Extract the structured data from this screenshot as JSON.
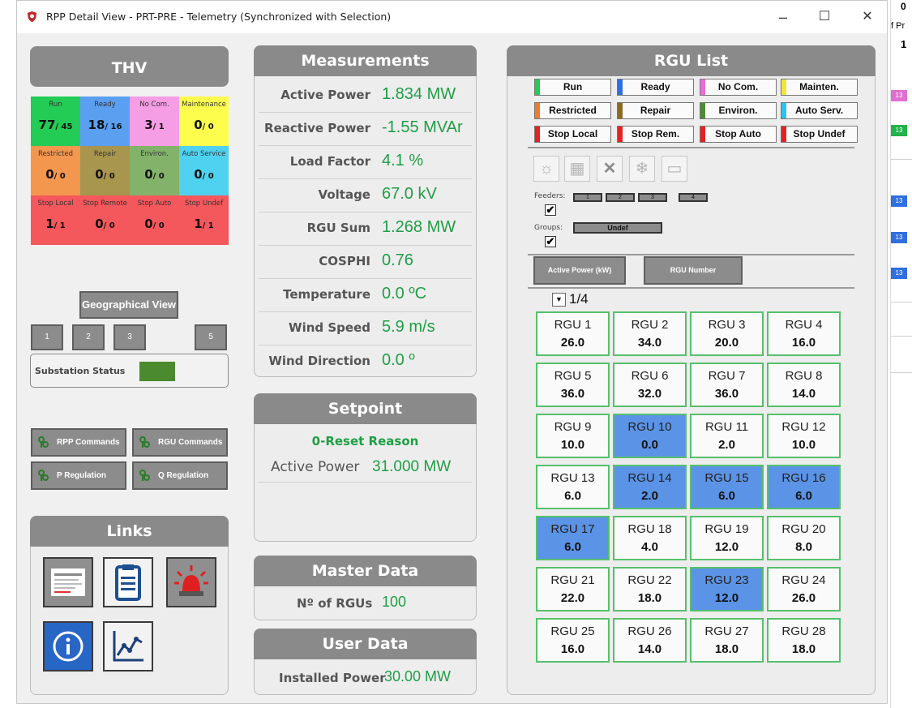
{
  "window": {
    "title": "RPP Detail View - PRT-PRE - Telemetry (Synchronized with Selection)",
    "minimize": "–",
    "maximize": "☐",
    "close": "✕"
  },
  "thv": {
    "title": "THV",
    "cells": [
      {
        "label": "Run",
        "count": "77",
        "sub": "45",
        "color": "#22cc55"
      },
      {
        "label": "Ready",
        "count": "18",
        "sub": "16",
        "color": "#5a9ff0"
      },
      {
        "label": "No Com.",
        "count": "3",
        "sub": "1",
        "color": "#f59de5"
      },
      {
        "label": "Maintenance",
        "count": "0",
        "sub": "0",
        "color": "#fdfd4e"
      },
      {
        "label": "Restricted",
        "count": "0",
        "sub": "0",
        "color": "#f3964e"
      },
      {
        "label": "Repair",
        "count": "0",
        "sub": "0",
        "color": "#a8954e"
      },
      {
        "label": "Environ.",
        "count": "0",
        "sub": "0",
        "color": "#83b36a"
      },
      {
        "label": "Auto Service",
        "count": "0",
        "sub": "0",
        "color": "#4fd2f0"
      },
      {
        "label": "Stop Local",
        "count": "1",
        "sub": "1",
        "color": "#f4585c"
      },
      {
        "label": "Stop Remote",
        "count": "0",
        "sub": "0",
        "color": "#f4585c"
      },
      {
        "label": "Stop Auto",
        "count": "0",
        "sub": "0",
        "color": "#f4585c"
      },
      {
        "label": "Stop Undef",
        "count": "1",
        "sub": "1",
        "color": "#f4585c"
      }
    ]
  },
  "geo": {
    "label": "Geographical View",
    "buttons": [
      "1",
      "2",
      "3",
      "5"
    ]
  },
  "substation": {
    "label": "Substation Status",
    "color": "#4b8a2e"
  },
  "commands": {
    "rpp": "RPP Commands",
    "rgu": "RGU Commands",
    "p_reg": "P Regulation",
    "q_reg": "Q Regulation"
  },
  "links": {
    "title": "Links",
    "icons": [
      "report-icon",
      "clipboard-icon",
      "alarm-siren-icon",
      "info-icon",
      "trend-chart-icon"
    ]
  },
  "measurements": {
    "title": "Measurements",
    "rows": [
      {
        "label": "Active Power",
        "value": "1.834 MW"
      },
      {
        "label": "Reactive Power",
        "value": "-1.55 MVAr"
      },
      {
        "label": "Load Factor",
        "value": "4.1 %"
      },
      {
        "label": "Voltage",
        "value": "67.0 kV"
      },
      {
        "label": "RGU Sum",
        "value": "1.268 MW"
      },
      {
        "label": "COSPHI",
        "value": "0.76"
      },
      {
        "label": "Temperature",
        "value": "0.0 ºC"
      },
      {
        "label": "Wind Speed",
        "value": "5.9 m/s"
      },
      {
        "label": "Wind Direction",
        "value": "0.0 º"
      }
    ]
  },
  "setpoint": {
    "title": "Setpoint",
    "reason": "0-Reset Reason",
    "active_power_label": "Active Power",
    "active_power_value": "31.000 MW"
  },
  "master_data": {
    "title": "Master Data",
    "label": "Nº of RGUs",
    "value": "100"
  },
  "user_data": {
    "title": "User Data",
    "label": "Installed Power",
    "value": "30.00 MW"
  },
  "rgu_list": {
    "title": "RGU List",
    "legend": [
      {
        "label": "Run",
        "color": "#22cc55"
      },
      {
        "label": "Ready",
        "color": "#2f6fe0"
      },
      {
        "label": "No Com.",
        "color": "#ea6bd8"
      },
      {
        "label": "Mainten.",
        "color": "#f3e636"
      },
      {
        "label": "Restricted",
        "color": "#f07a33"
      },
      {
        "label": "Repair",
        "color": "#8c6a24"
      },
      {
        "label": "Environ.",
        "color": "#4f8a39"
      },
      {
        "label": "Auto Serv.",
        "color": "#28c4ee"
      },
      {
        "label": "Stop Local",
        "color": "#e32222"
      },
      {
        "label": "Stop Rem.",
        "color": "#e32222"
      },
      {
        "label": "Stop Auto",
        "color": "#e32222"
      },
      {
        "label": "Stop Undef",
        "color": "#e32222"
      }
    ],
    "tools": [
      "beacon-icon",
      "cabinet-icon",
      "x-icon",
      "snowflake-icon",
      "display-icon"
    ],
    "feeders_label": "Feeders:",
    "feeders": [
      "1",
      "2",
      "3",
      "4"
    ],
    "feeders_checked": "✔",
    "groups_label": "Groups:",
    "groups_value": "Undef",
    "groups_checked": "✔",
    "sort_active_power": "Active Power (kW)",
    "sort_rgu_number": "RGU Number",
    "page": "1/4",
    "page_dropdown": "▼",
    "tiles": [
      {
        "name": "RGU 1",
        "value": "26.0",
        "selected": false
      },
      {
        "name": "RGU 2",
        "value": "34.0",
        "selected": false
      },
      {
        "name": "RGU 3",
        "value": "20.0",
        "selected": false
      },
      {
        "name": "RGU 4",
        "value": "16.0",
        "selected": false
      },
      {
        "name": "RGU 5",
        "value": "36.0",
        "selected": false
      },
      {
        "name": "RGU 6",
        "value": "32.0",
        "selected": false
      },
      {
        "name": "RGU 7",
        "value": "36.0",
        "selected": false
      },
      {
        "name": "RGU 8",
        "value": "14.0",
        "selected": false
      },
      {
        "name": "RGU 9",
        "value": "10.0",
        "selected": false
      },
      {
        "name": "RGU 10",
        "value": "0.0",
        "selected": true
      },
      {
        "name": "RGU 11",
        "value": "2.0",
        "selected": false
      },
      {
        "name": "RGU 12",
        "value": "10.0",
        "selected": false
      },
      {
        "name": "RGU 13",
        "value": "6.0",
        "selected": false
      },
      {
        "name": "RGU 14",
        "value": "2.0",
        "selected": true
      },
      {
        "name": "RGU 15",
        "value": "6.0",
        "selected": true
      },
      {
        "name": "RGU 16",
        "value": "6.0",
        "selected": true
      },
      {
        "name": "RGU 17",
        "value": "6.0",
        "selected": true
      },
      {
        "name": "RGU 18",
        "value": "4.0",
        "selected": false
      },
      {
        "name": "RGU 19",
        "value": "12.0",
        "selected": false
      },
      {
        "name": "RGU 20",
        "value": "8.0",
        "selected": false
      },
      {
        "name": "RGU 21",
        "value": "22.0",
        "selected": false
      },
      {
        "name": "RGU 22",
        "value": "18.0",
        "selected": false
      },
      {
        "name": "RGU 23",
        "value": "12.0",
        "selected": true
      },
      {
        "name": "RGU 24",
        "value": "26.0",
        "selected": false
      },
      {
        "name": "RGU 25",
        "value": "16.0",
        "selected": false
      },
      {
        "name": "RGU 26",
        "value": "14.0",
        "selected": false
      },
      {
        "name": "RGU 27",
        "value": "18.0",
        "selected": false
      },
      {
        "name": "RGU 28",
        "value": "18.0",
        "selected": false
      }
    ]
  },
  "background": {
    "top_texts": [
      "0",
      "f Pr",
      "1"
    ],
    "badges": [
      {
        "text": "13",
        "color": "#e070d0"
      },
      {
        "text": "13",
        "color": "#22b34a"
      },
      {
        "text": "13",
        "color": "#2f6fe0"
      },
      {
        "text": "13",
        "color": "#2f6fe0"
      },
      {
        "text": "13",
        "color": "#2f6fe0"
      }
    ]
  }
}
